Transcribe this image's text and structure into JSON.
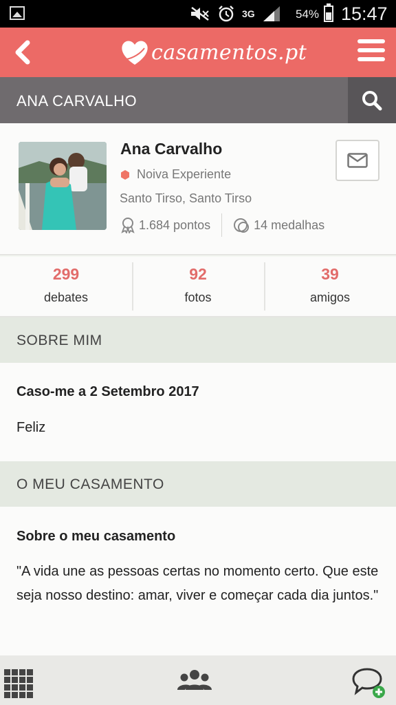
{
  "status_bar": {
    "network": "3G",
    "battery": "54%",
    "time": "15:47"
  },
  "app_bar": {
    "logo_text": "casamentos.pt"
  },
  "name_bar": {
    "title": "ANA CARVALHO"
  },
  "profile": {
    "name": "Ana Carvalho",
    "level": "Noiva Experiente",
    "location": "Santo Tirso, Santo Tirso",
    "points": "1.684 pontos",
    "medals": "14 medalhas"
  },
  "counters": [
    {
      "value": "299",
      "label": "debates"
    },
    {
      "value": "92",
      "label": "fotos"
    },
    {
      "value": "39",
      "label": "amigos"
    }
  ],
  "about": {
    "header": "SOBRE MIM",
    "subtitle": "Caso-me a 2 Setembro 2017",
    "text": "Feliz"
  },
  "wedding": {
    "header": "O MEU CASAMENTO",
    "subtitle": "Sobre o meu casamento",
    "text": "\"A vida une as pessoas certas no momento certo. Que este seja nosso destino: amar, viver e começar cada dia juntos.\""
  },
  "colors": {
    "brand": "#ec6a66",
    "namebar": "#6f6b6e",
    "counter_number": "#e26c6a",
    "level_badge": "#ef7566"
  },
  "icons": {
    "back": "chevron-left-icon",
    "menu": "hamburger-menu-icon",
    "search": "search-icon",
    "message": "envelope-icon",
    "points": "award-ribbon-icon",
    "medals": "medal-icon",
    "bottom_grid": "grid-icon",
    "bottom_community": "people-icon",
    "bottom_chat": "chat-add-icon"
  }
}
